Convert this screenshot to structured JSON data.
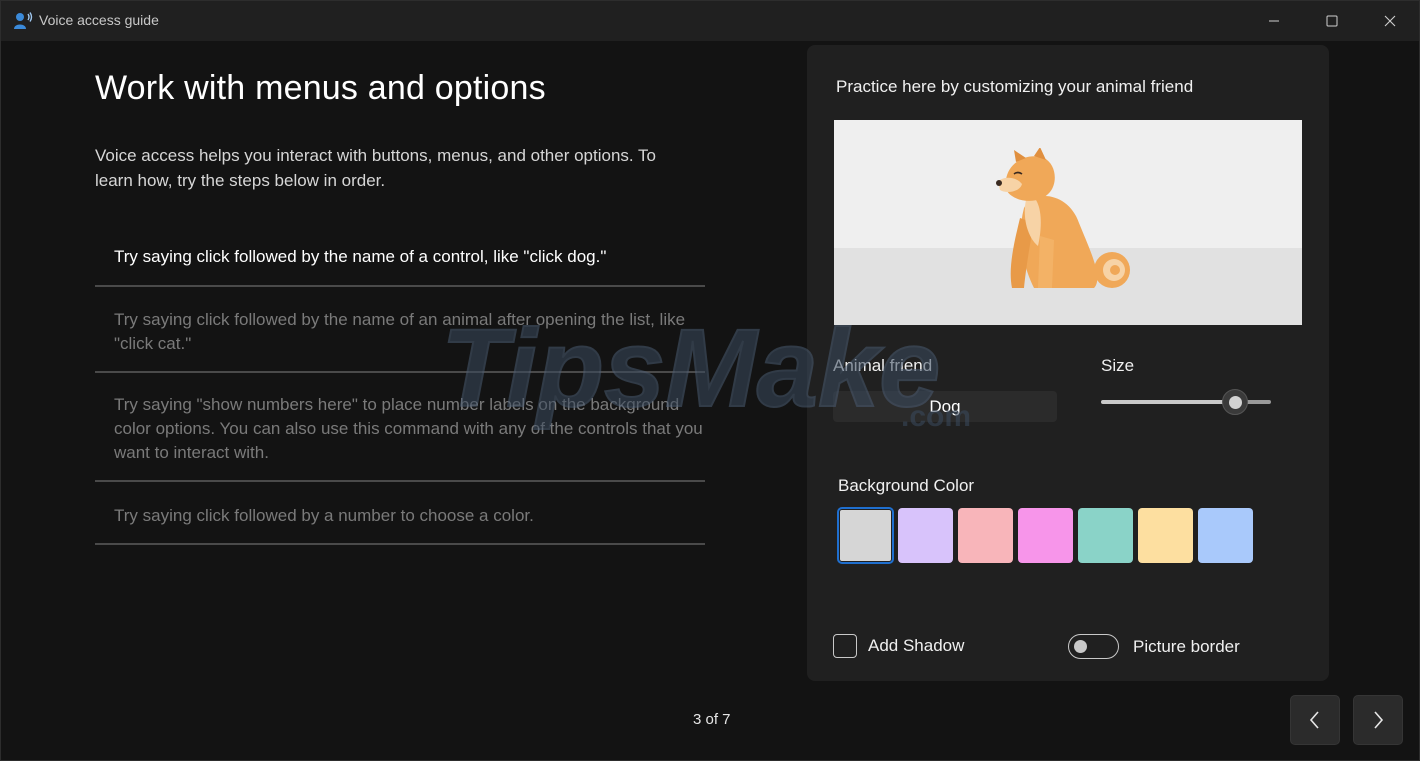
{
  "window": {
    "title": "Voice access guide"
  },
  "page": {
    "title": "Work with menus and options",
    "intro": "Voice access helps you interact with buttons, menus, and other options. To learn how, try the steps below in order.",
    "steps": [
      "Try saying click followed by the name of a control, like \"click dog.\"",
      "Try saying click followed by the name of an animal after opening the list, like \"click cat.\"",
      "Try saying \"show numbers here\" to place number labels on the background color options. You can also use this command with any of the controls that you want to interact with.",
      "Try saying click followed by a number to choose a color."
    ],
    "active_step": 1
  },
  "practice": {
    "heading": "Practice here by customizing your animal friend",
    "animal_label": "Animal friend",
    "animal_value": "Dog",
    "size_label": "Size",
    "size_value_fraction": 0.79,
    "bg_label": "Background Color",
    "bg_colors": [
      "#d6d6d6",
      "#d8c3fb",
      "#f8b5ba",
      "#f795ea",
      "#8ad3c8",
      "#fddfa0",
      "#a9c9fb"
    ],
    "bg_selected_index": 0,
    "shadow_label": "Add Shadow",
    "shadow_checked": false,
    "border_label": "Picture border",
    "border_on": false
  },
  "pagination": {
    "text": "3 of 7"
  },
  "watermark": {
    "text": "TipsMake",
    "suffix": ".com"
  },
  "colors": {
    "accent": "#1f6fcf",
    "dog_body": "#f0a858",
    "dog_light": "#f7d3a6"
  }
}
